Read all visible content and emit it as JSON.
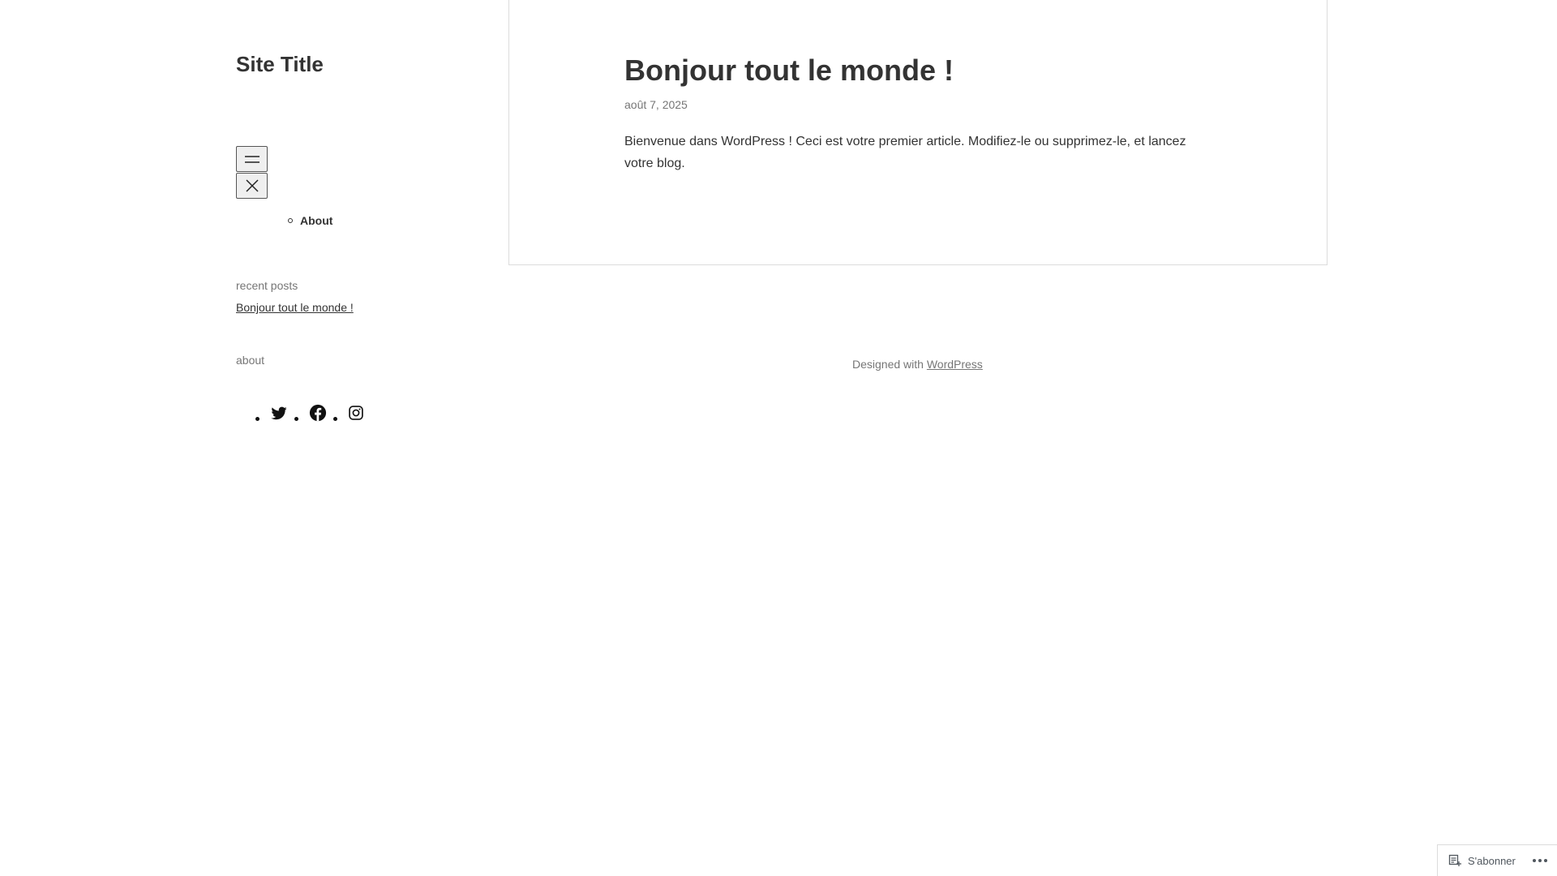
{
  "site": {
    "title": "Site Title"
  },
  "navigation": {
    "open_menu_icon": "hamburger-icon",
    "close_menu_icon": "close-icon",
    "items": [
      {
        "label": "About"
      }
    ]
  },
  "widgets": {
    "recent_posts_title": "recent posts",
    "recent_posts": [
      {
        "label": "Bonjour tout le monde !"
      }
    ],
    "about_title": "about",
    "social_icons": [
      "twitter-icon",
      "facebook-icon",
      "instagram-icon"
    ]
  },
  "post": {
    "title": "Bonjour tout le monde !",
    "date": "août 7, 2025",
    "body": "Bienvenue dans WordPress ! Ceci est votre premier article. Modifiez-le ou supprimez-le, et lancez votre blog."
  },
  "footer": {
    "prefix": "Designed with ",
    "link": "WordPress"
  },
  "subscribe_bar": {
    "label": "S'abonner",
    "icon": "reader-icon",
    "more_icon": "ellipsis-icon"
  },
  "colors": {
    "text": "#333333",
    "muted": "#767676",
    "border": "#dcdcdc",
    "background": "#ffffff"
  }
}
